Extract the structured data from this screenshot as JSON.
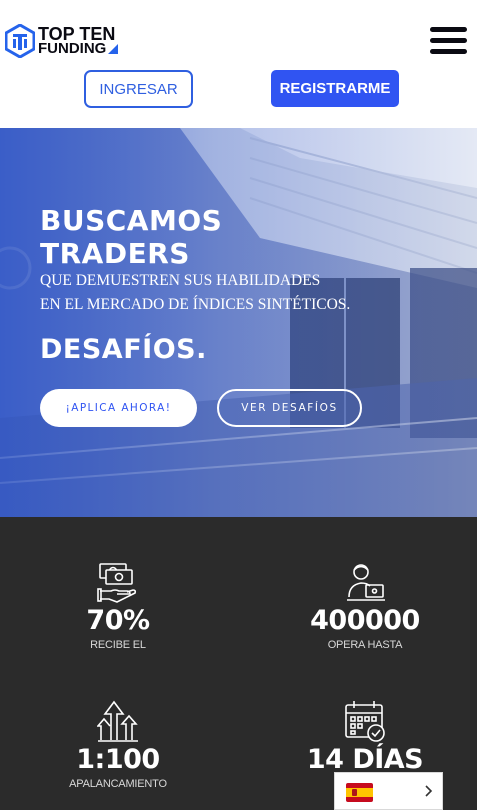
{
  "header": {
    "logo": {
      "line1": "TOP TEN",
      "line2": "FUNDING"
    },
    "login_label": "INGRESAR",
    "register_label": "REGISTRARME",
    "menu_icon": "hamburger-menu-icon"
  },
  "hero": {
    "title_line1": "BUSCAMOS",
    "title_line2": "TRADERS",
    "subtitle_line1": "QUE DEMUESTREN SUS HABILIDADES",
    "subtitle_line2": "EN EL MERCADO DE ÍNDICES SINTÉTICOS.",
    "heading2": "DESAFÍOS.",
    "apply_label": "¡APLICA AHORA!",
    "challenges_label": "VER DESAFÍOS"
  },
  "stats": [
    {
      "icon": "money-hand-icon",
      "value": "70%",
      "label": "RECIBE EL"
    },
    {
      "icon": "trader-laptop-icon",
      "value": "400000",
      "label": "OPERA HASTA"
    },
    {
      "icon": "growth-arrows-icon",
      "value": "1:100",
      "label": "APALANCAMIENTO"
    },
    {
      "icon": "calendar-check-icon",
      "value": "14 DÍAS",
      "label": ""
    }
  ],
  "language": {
    "selected": "Spanish",
    "flag_icon": "spain-flag-icon",
    "chevron_icon": "chevron-right-icon"
  },
  "colors": {
    "accent": "#3054f2",
    "stats_bg": "#2b2b2b",
    "logo_dark": "#0a0a12"
  }
}
